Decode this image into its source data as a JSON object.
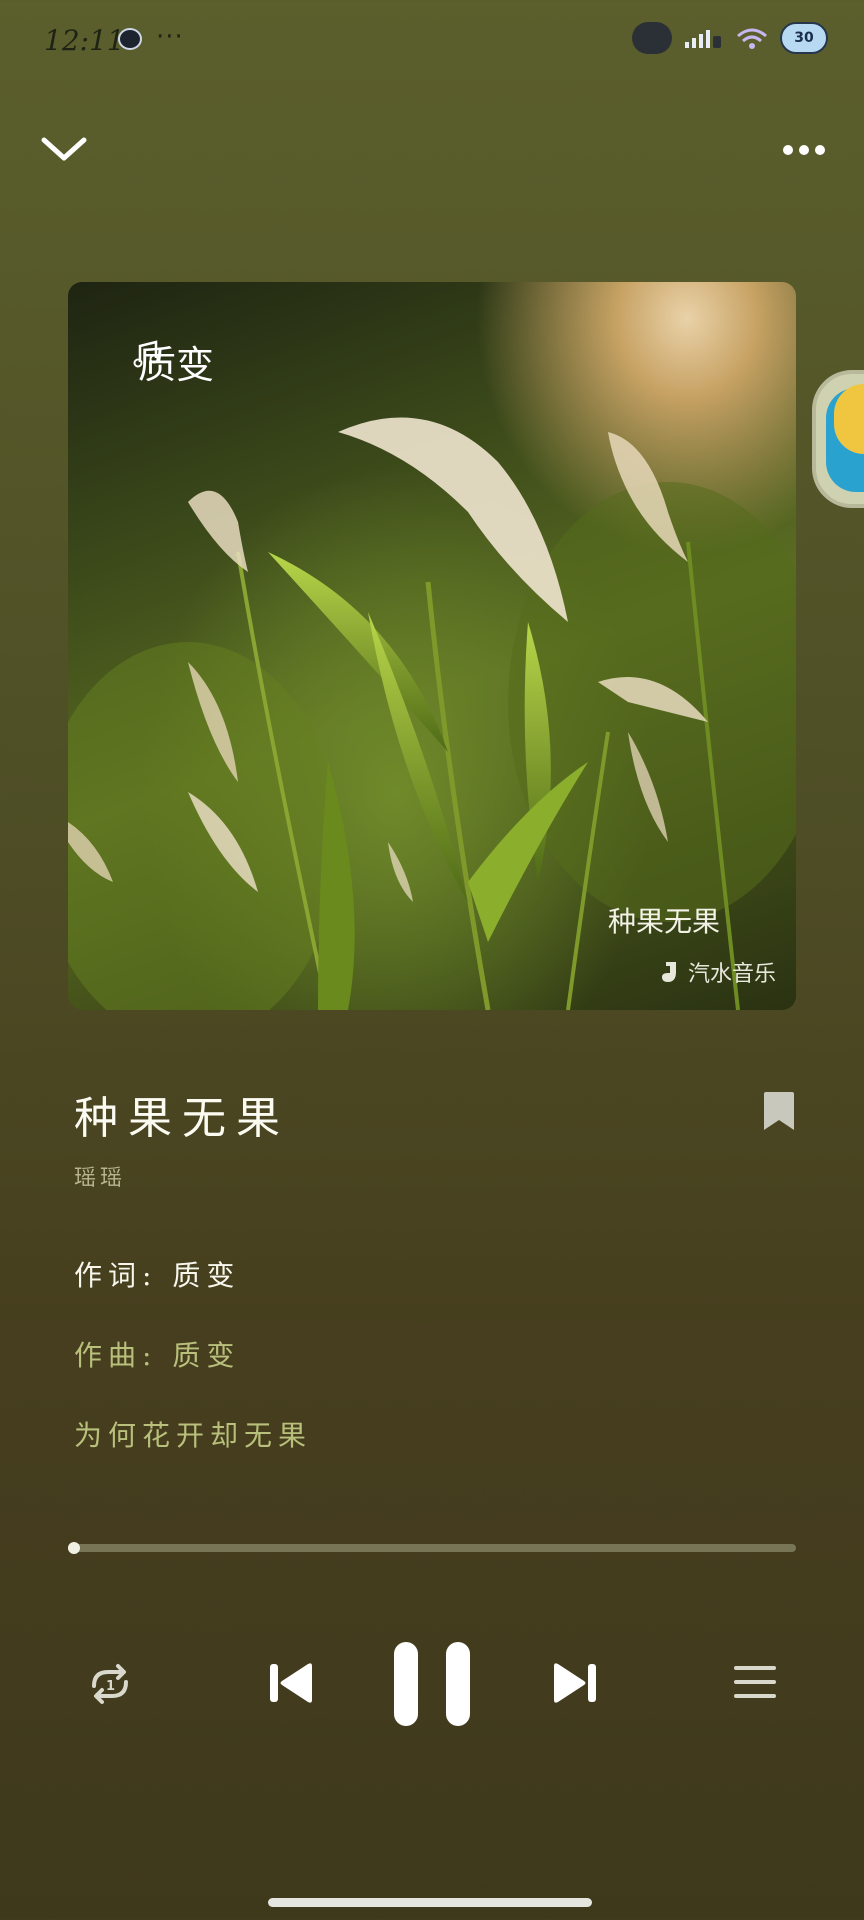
{
  "status_bar": {
    "time": "12:11",
    "dots": "···",
    "battery": "30"
  },
  "album": {
    "art_title": "质变",
    "art_bottom_title": "种果无果",
    "watermark": "汽水音乐"
  },
  "song": {
    "title": "种果无果",
    "artist": "瑶瑶"
  },
  "lyrics": [
    "作词:  质变",
    "作曲:  质变",
    "为何花开却无果"
  ],
  "playback": {
    "progress": 0.01,
    "state": "playing"
  },
  "colors": {
    "background_top": "#5b5f2c",
    "background_bottom": "#3f391c",
    "lyric_active": "#f7f7ee",
    "lyric_inactive": "#b8c07b"
  },
  "icons": {
    "collapse": "chevron-down-icon",
    "more": "more-dots-icon",
    "bookmark": "bookmark-icon",
    "repeat": "repeat-one-icon",
    "previous": "skip-previous-icon",
    "pause": "pause-icon",
    "next": "skip-next-icon",
    "playlist": "playlist-icon"
  }
}
